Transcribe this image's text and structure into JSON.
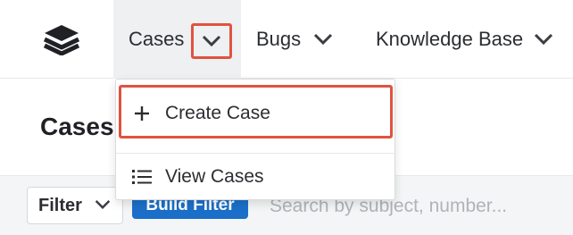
{
  "nav": {
    "logo_icon": "stack-layers-icon",
    "items": [
      {
        "label": "Cases",
        "icon": "chevron-down-icon"
      },
      {
        "label": "Bugs",
        "icon": "chevron-down-icon"
      },
      {
        "label": "Knowledge Base",
        "icon": "chevron-down-icon"
      }
    ]
  },
  "dropdown": {
    "items": [
      {
        "label": "Create Case",
        "icon": "plus-icon"
      },
      {
        "label": "View Cases",
        "icon": "list-icon"
      }
    ]
  },
  "page": {
    "title": "Cases"
  },
  "filter": {
    "filter_label": "Filter",
    "build_filter_label": "Build Filter",
    "search_placeholder": "Search by subject, number..."
  },
  "colors": {
    "highlight": "#e0533f",
    "primary": "#1b6fc9",
    "active_nav_bg": "#eef0f2"
  }
}
